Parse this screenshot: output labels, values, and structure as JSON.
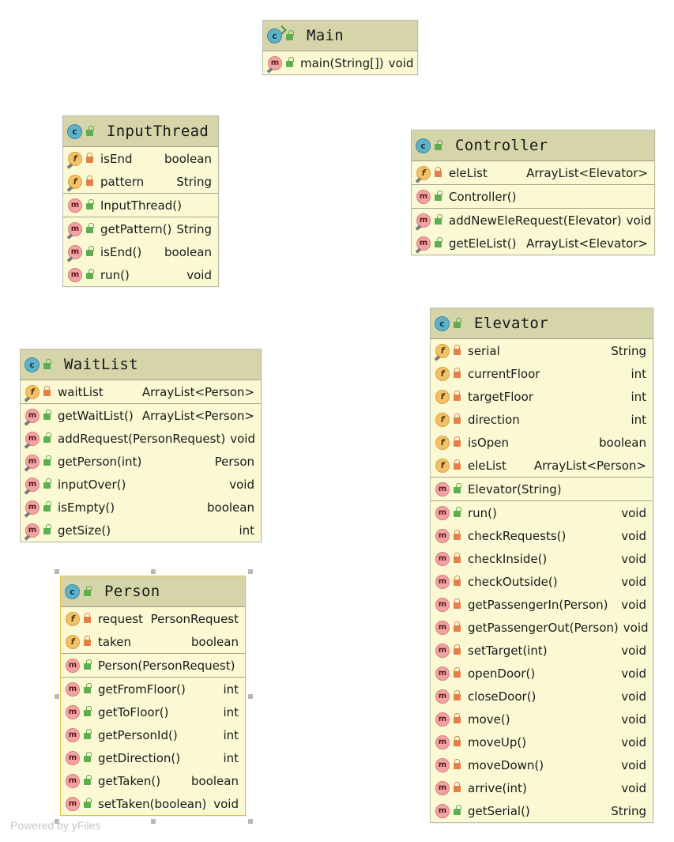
{
  "watermark": "Powered by yFiles",
  "classes": {
    "main": {
      "name": "Main",
      "methods": [
        {
          "name": "main(String[])",
          "type": "void"
        }
      ]
    },
    "input_thread": {
      "name": "InputThread",
      "fields": [
        {
          "name": "isEnd",
          "type": "boolean"
        },
        {
          "name": "pattern",
          "type": "String"
        }
      ],
      "constructors": [
        {
          "name": "InputThread()",
          "type": ""
        }
      ],
      "methods": [
        {
          "name": "getPattern()",
          "type": "String"
        },
        {
          "name": "isEnd()",
          "type": "boolean"
        },
        {
          "name": "run()",
          "type": "void"
        }
      ]
    },
    "controller": {
      "name": "Controller",
      "fields": [
        {
          "name": "eleList",
          "type": "ArrayList<Elevator>"
        }
      ],
      "constructors": [
        {
          "name": "Controller()",
          "type": ""
        }
      ],
      "methods": [
        {
          "name": "addNewEleRequest(Elevator)",
          "type": "void"
        },
        {
          "name": "getEleList()",
          "type": "ArrayList<Elevator>"
        }
      ]
    },
    "wait_list": {
      "name": "WaitList",
      "fields": [
        {
          "name": "waitList",
          "type": "ArrayList<Person>"
        }
      ],
      "methods": [
        {
          "name": "getWaitList()",
          "type": "ArrayList<Person>"
        },
        {
          "name": "addRequest(PersonRequest)",
          "type": "void"
        },
        {
          "name": "getPerson(int)",
          "type": "Person"
        },
        {
          "name": "inputOver()",
          "type": "void"
        },
        {
          "name": "isEmpty()",
          "type": "boolean"
        },
        {
          "name": "getSize()",
          "type": "int"
        }
      ]
    },
    "elevator": {
      "name": "Elevator",
      "fields": [
        {
          "name": "serial",
          "type": "String"
        },
        {
          "name": "currentFloor",
          "type": "int"
        },
        {
          "name": "targetFloor",
          "type": "int"
        },
        {
          "name": "direction",
          "type": "int"
        },
        {
          "name": "isOpen",
          "type": "boolean"
        },
        {
          "name": "eleList",
          "type": "ArrayList<Person>"
        }
      ],
      "constructors": [
        {
          "name": "Elevator(String)",
          "type": ""
        }
      ],
      "methods": [
        {
          "name": "run()",
          "type": "void"
        },
        {
          "name": "checkRequests()",
          "type": "void"
        },
        {
          "name": "checkInside()",
          "type": "void"
        },
        {
          "name": "checkOutside()",
          "type": "void"
        },
        {
          "name": "getPassengerIn(Person)",
          "type": "void"
        },
        {
          "name": "getPassengerOut(Person)",
          "type": "void"
        },
        {
          "name": "setTarget(int)",
          "type": "void"
        },
        {
          "name": "openDoor()",
          "type": "void"
        },
        {
          "name": "closeDoor()",
          "type": "void"
        },
        {
          "name": "move()",
          "type": "void"
        },
        {
          "name": "moveUp()",
          "type": "void"
        },
        {
          "name": "moveDown()",
          "type": "void"
        },
        {
          "name": "arrive(int)",
          "type": "void"
        },
        {
          "name": "getSerial()",
          "type": "String"
        }
      ]
    },
    "person": {
      "name": "Person",
      "fields": [
        {
          "name": "request",
          "type": "PersonRequest"
        },
        {
          "name": "taken",
          "type": "boolean"
        }
      ],
      "constructors": [
        {
          "name": "Person(PersonRequest)",
          "type": ""
        }
      ],
      "methods": [
        {
          "name": "getFromFloor()",
          "type": "int"
        },
        {
          "name": "getToFloor()",
          "type": "int"
        },
        {
          "name": "getPersonId()",
          "type": "int"
        },
        {
          "name": "getDirection()",
          "type": "int"
        },
        {
          "name": "getTaken()",
          "type": "boolean"
        },
        {
          "name": "setTaken(boolean)",
          "type": "void"
        }
      ]
    }
  }
}
